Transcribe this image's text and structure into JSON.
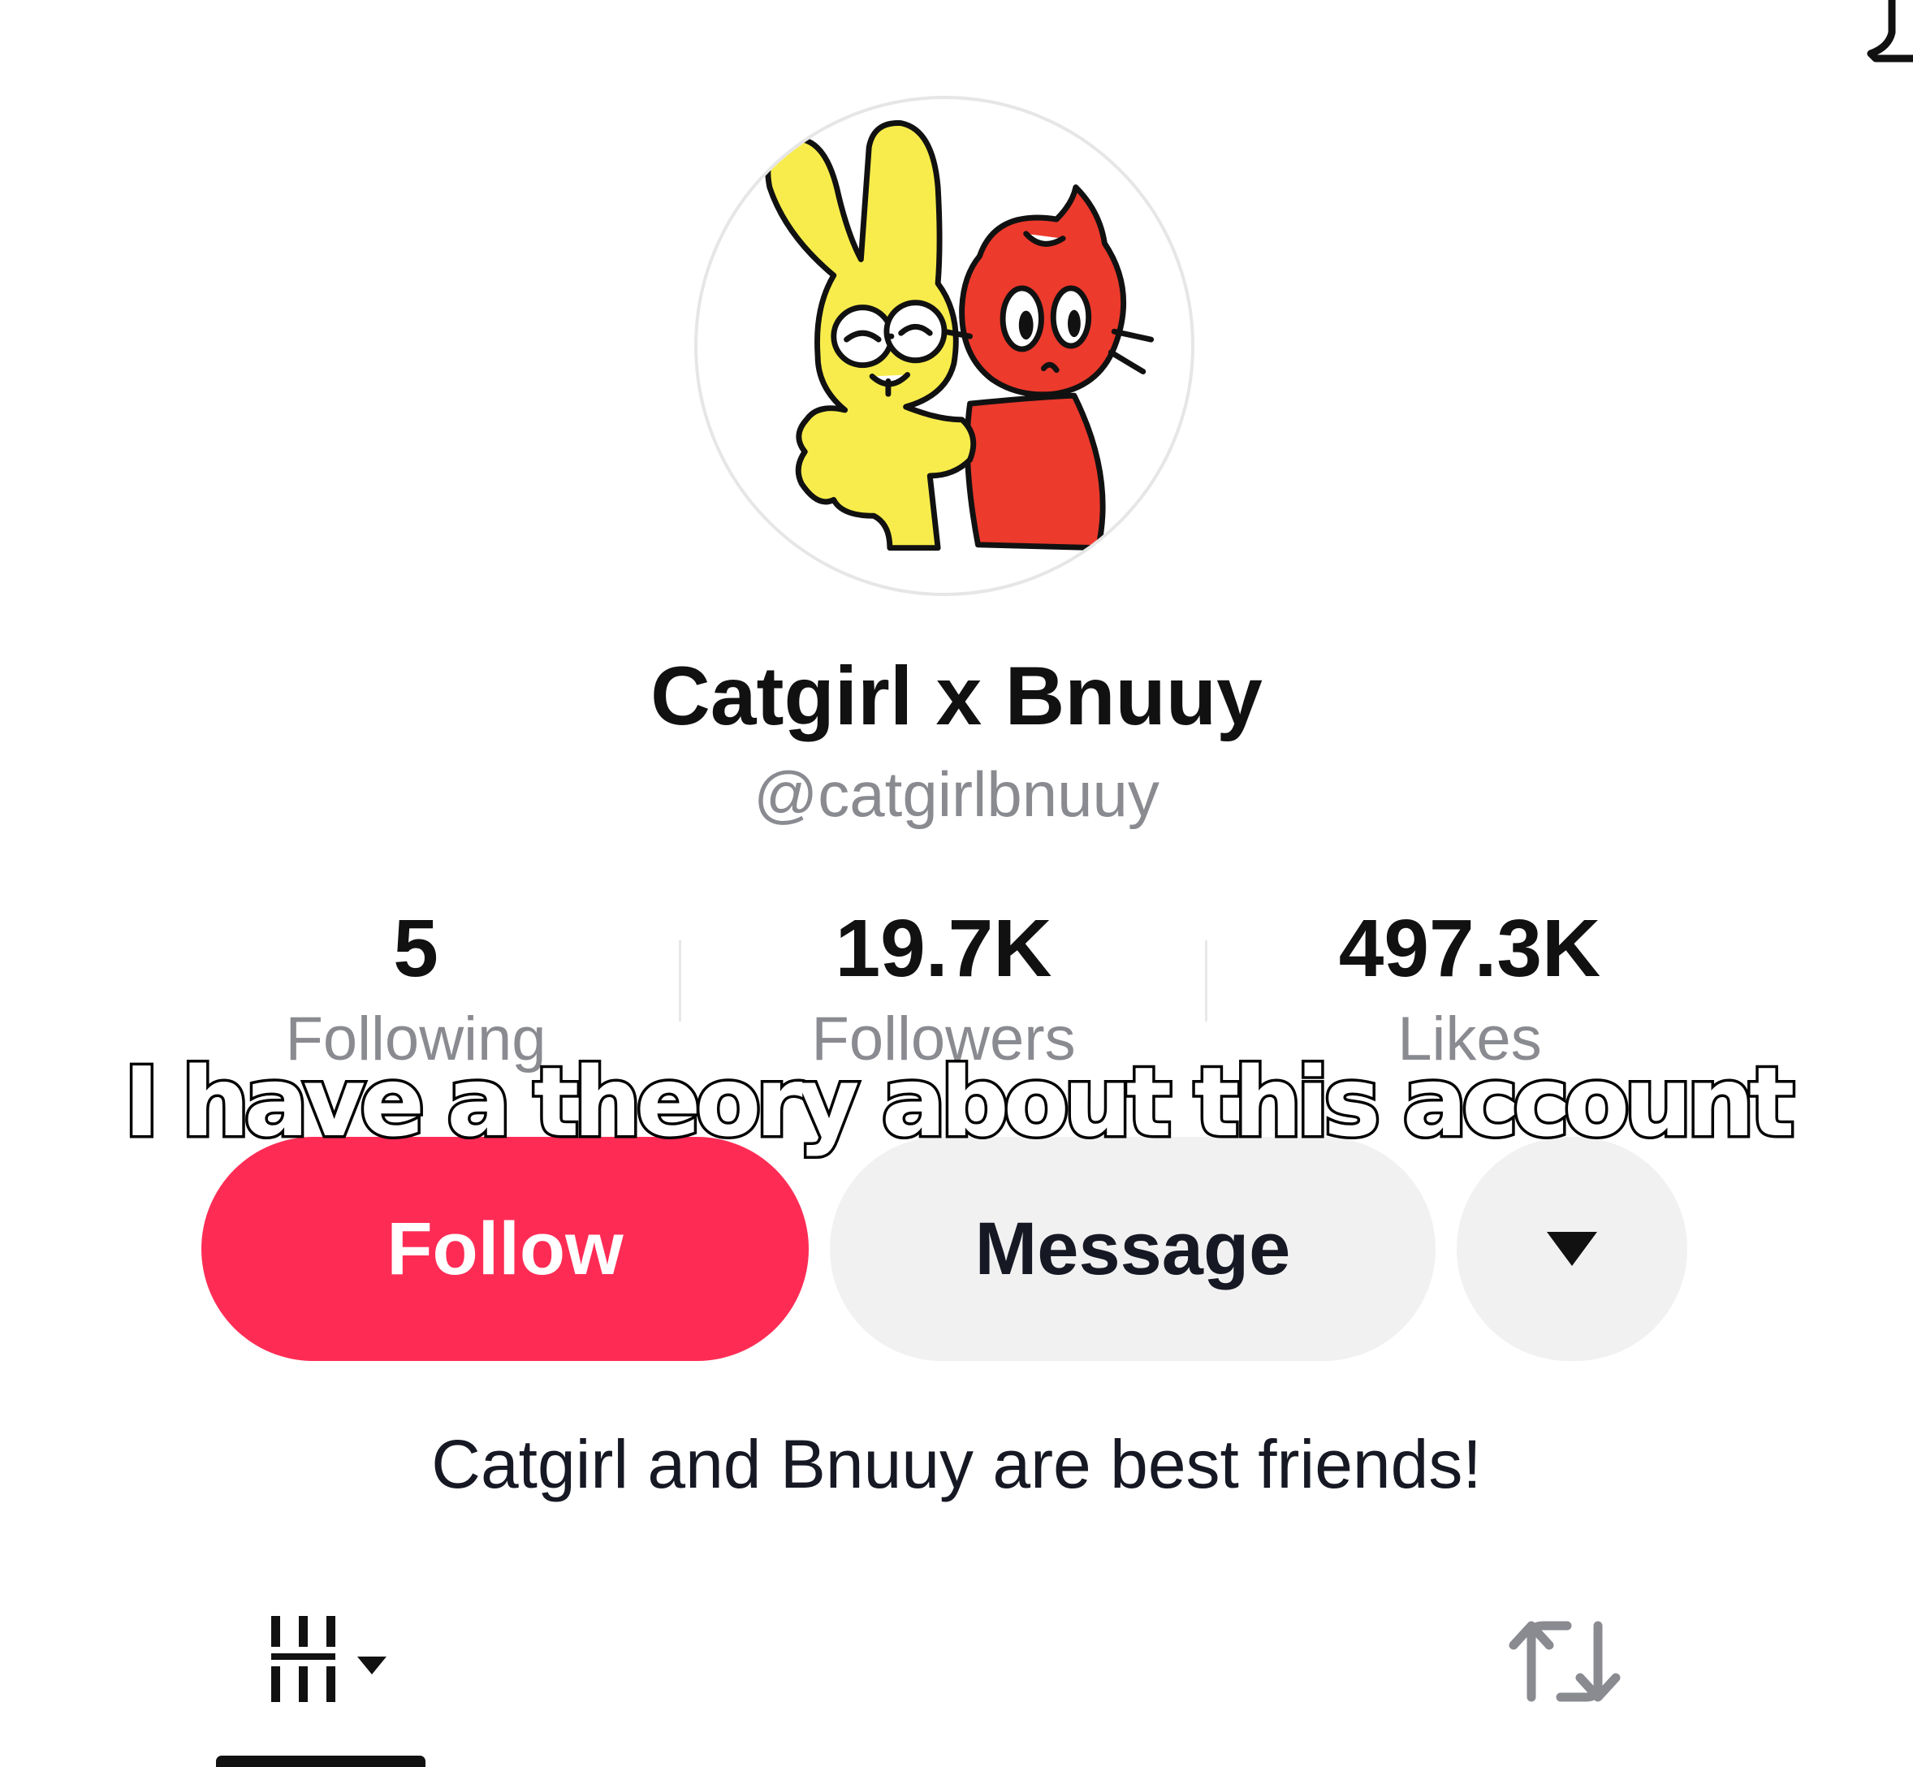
{
  "profile": {
    "display_name": "Catgirl x Bnuuy",
    "username": "@catgirlbnuuy",
    "bio": "Catgirl and Bnuuy are best friends!"
  },
  "stats": {
    "following": {
      "value": "5",
      "label": "Following"
    },
    "followers": {
      "value": "19.7K",
      "label": "Followers"
    },
    "likes": {
      "value": "497.3K",
      "label": "Likes"
    }
  },
  "actions": {
    "follow_label": "Follow",
    "message_label": "Message",
    "more_icon": "caret-down-icon"
  },
  "overlay": {
    "caption": "I have a theory about this account"
  },
  "tabs": [
    {
      "icon": "videos-grid-icon",
      "selected": true
    },
    {
      "icon": "repost-icon",
      "selected": false
    }
  ],
  "colors": {
    "follow_button": "#fe2c55",
    "secondary_button": "#f1f1f2",
    "muted_text": "#8a8b91",
    "avatar_bunny": "#f7ec4b",
    "avatar_cat": "#ec3a2c"
  }
}
